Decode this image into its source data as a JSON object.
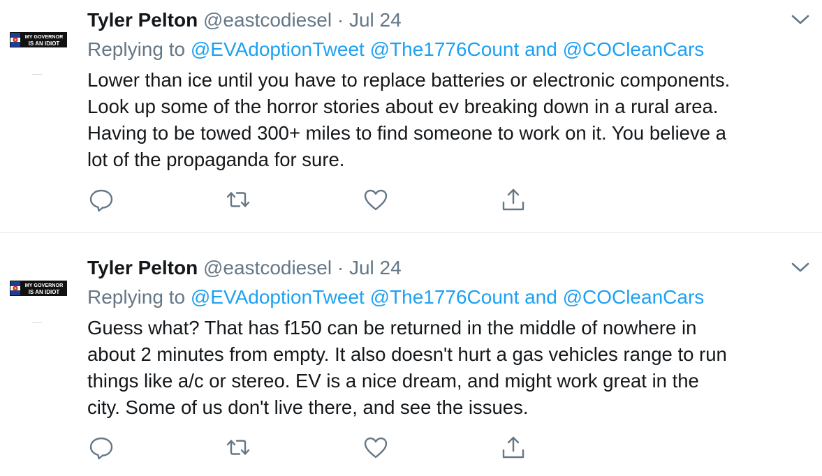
{
  "tweets": [
    {
      "author": {
        "name": "Tyler Pelton",
        "handle": "@eastcodiesel",
        "avatar_text_top": "MY GOVERNOR",
        "avatar_text_bottom": "IS AN IDIOT"
      },
      "separator": "·",
      "date": "Jul 24",
      "replying_prefix": "Replying to",
      "mentions": [
        "@EVAdoptionTweet",
        "@The1776Count",
        "@COCleanCars"
      ],
      "mention_joiner": "and",
      "text_lines": [
        "Lower than ice until you have to replace batteries or electronic components.",
        "Look up some of the horror stories about ev breaking down in a rural area.",
        "Having to be towed 300+ miles to find someone to work on it. You believe a",
        "lot of the propaganda for sure."
      ]
    },
    {
      "author": {
        "name": "Tyler Pelton",
        "handle": "@eastcodiesel",
        "avatar_text_top": "MY GOVERNOR",
        "avatar_text_bottom": "IS AN IDIOT"
      },
      "separator": "·",
      "date": "Jul 24",
      "replying_prefix": "Replying to",
      "mentions": [
        "@EVAdoptionTweet",
        "@The1776Count",
        "@COCleanCars"
      ],
      "mention_joiner": "and",
      "text_lines": [
        "Guess what? That has f150 can be returned in the middle of nowhere in",
        "about 2 minutes from empty. It also doesn't hurt a gas vehicles range to run",
        "things like a/c or stereo. EV is a nice dream, and might work great in the",
        "city. Some of us don't live there, and see the issues."
      ]
    }
  ],
  "icons": {
    "menu": "chevron-down-icon",
    "reply": "reply-icon",
    "retweet": "retweet-icon",
    "like": "heart-icon",
    "share": "share-icon"
  },
  "colors": {
    "link": "#1da1f2",
    "secondary_text": "#657786",
    "primary_text": "#14171a",
    "divider": "#e1e8ed"
  }
}
